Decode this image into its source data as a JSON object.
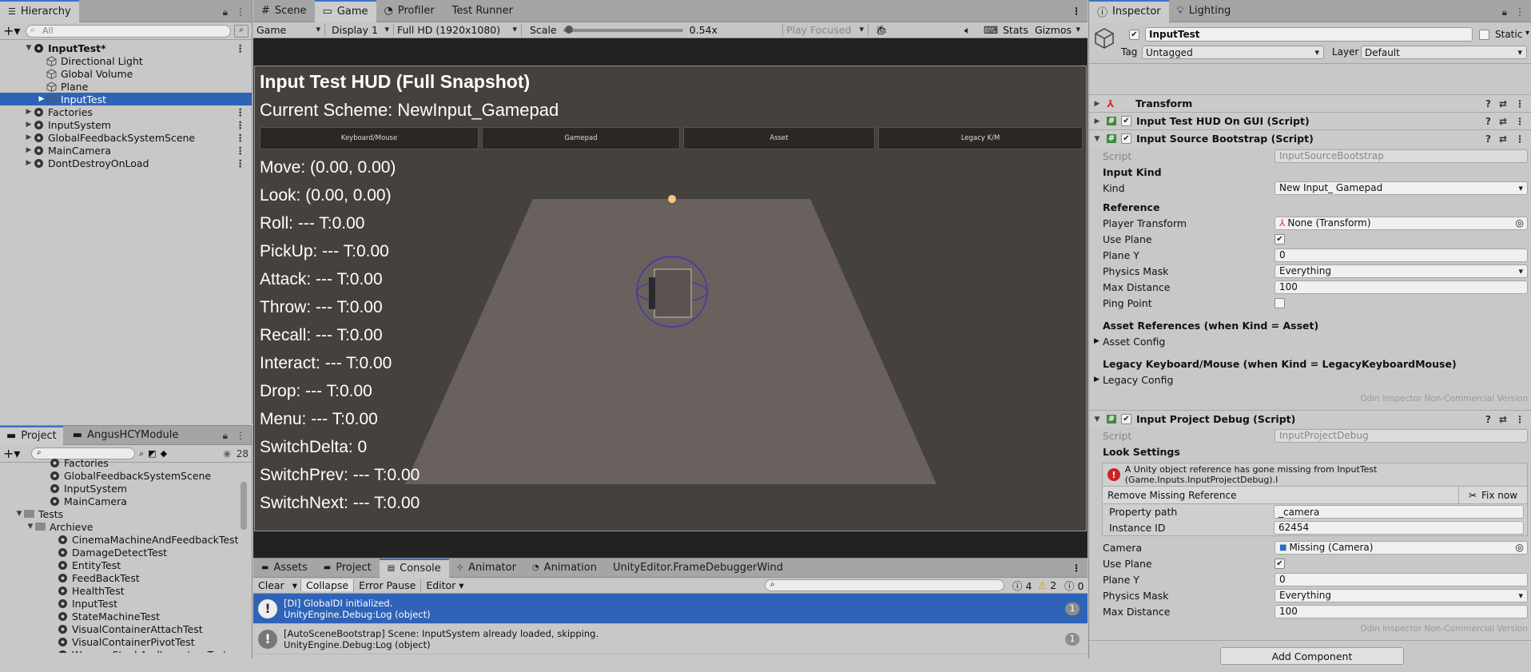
{
  "hierarchy": {
    "tab": "Hierarchy",
    "search_placeholder": "All",
    "scene": "InputTest*",
    "children": [
      "Directional Light",
      "Global Volume",
      "Plane",
      "InputTest"
    ],
    "roots": [
      "Factories",
      "InputSystem",
      "GlobalFeedbackSystemScene",
      "MainCamera",
      "DontDestroyOnLoad"
    ]
  },
  "project": {
    "tabs": [
      "Project",
      "AngusHCYModule"
    ],
    "hidden_count": "28",
    "items": [
      {
        "label": "Factories",
        "depth": 2,
        "type": "scene"
      },
      {
        "label": "GlobalFeedbackSystemScene",
        "depth": 2,
        "type": "scene"
      },
      {
        "label": "InputSystem",
        "depth": 2,
        "type": "scene"
      },
      {
        "label": "MainCamera",
        "depth": 2,
        "type": "scene"
      },
      {
        "label": "Tests",
        "depth": 0,
        "type": "folder"
      },
      {
        "label": "Archieve",
        "depth": 1,
        "type": "folder"
      },
      {
        "label": "CinemaMachineAndFeedbackTest",
        "depth": 3,
        "type": "scene"
      },
      {
        "label": "DamageDetectTest",
        "depth": 3,
        "type": "scene"
      },
      {
        "label": "EntityTest",
        "depth": 3,
        "type": "scene"
      },
      {
        "label": "FeedBackTest",
        "depth": 3,
        "type": "scene"
      },
      {
        "label": "HealthTest",
        "depth": 3,
        "type": "scene"
      },
      {
        "label": "InputTest",
        "depth": 3,
        "type": "scene"
      },
      {
        "label": "StateMachineTest",
        "depth": 3,
        "type": "scene"
      },
      {
        "label": "VisualContainerAttachTest",
        "depth": 3,
        "type": "scene"
      },
      {
        "label": "VisualContainerPivotTest",
        "depth": 3,
        "type": "scene"
      },
      {
        "label": "WeaponStuckAndInventoryTest",
        "depth": 3,
        "type": "scene"
      }
    ]
  },
  "game_tabs": [
    "Scene",
    "Game",
    "Profiler",
    "Test Runner"
  ],
  "game_toolbar": {
    "view": "Game",
    "display": "Display 1",
    "resolution": "Full HD (1920x1080)",
    "scale_label": "Scale",
    "scale_value": "0.54x",
    "play_mode": "Play Focused",
    "stats": "Stats",
    "gizmos": "Gizmos",
    "scale_fraction": 0.02
  },
  "hud": {
    "title": "Input Test HUD (Full Snapshot)",
    "scheme": "Current Scheme: NewInput_Gamepad",
    "buttons": [
      "Keyboard/Mouse",
      "Gamepad",
      "Asset",
      "Legacy K/M"
    ],
    "lines": [
      "Move: (0.00, 0.00)",
      "Look: (0.00, 0.00)",
      "Roll: ---  T:0.00",
      "PickUp: ---  T:0.00",
      "Attack: ---  T:0.00",
      "Throw: ---  T:0.00",
      "Recall: ---  T:0.00",
      "Interact: ---  T:0.00",
      "Drop: ---  T:0.00",
      "Menu: ---  T:0.00",
      "SwitchDelta: 0",
      "SwitchPrev: ---  T:0.00",
      "SwitchNext: ---  T:0.00"
    ]
  },
  "console": {
    "tabs": [
      "Assets",
      "Project",
      "Console",
      "Animator",
      "Animation",
      "UnityEditor.FrameDebuggerWind"
    ],
    "toolbar": {
      "clear": "Clear",
      "collapse": "Collapse",
      "error_pause": "Error Pause",
      "editor": "Editor",
      "info_count": "4",
      "warn_count": "2",
      "error_count": "0"
    },
    "logs": [
      {
        "line1": "[DI] GlobalDI initialized.",
        "line2": "UnityEngine.Debug:Log (object)",
        "count": "1",
        "selected": true
      },
      {
        "line1": "[AutoSceneBootstrap] Scene: InputSystem already loaded, skipping.",
        "line2": "UnityEngine.Debug:Log (object)",
        "count": "1",
        "selected": false
      }
    ]
  },
  "inspector": {
    "tabs": [
      "Inspector",
      "Lighting"
    ],
    "object_name": "InputTest",
    "static_label": "Static",
    "tag_label": "Tag",
    "tag_value": "Untagged",
    "layer_label": "Layer",
    "layer_value": "Default",
    "components": {
      "transform": "Transform",
      "hud": "Input Test HUD On GUI (Script)",
      "bootstrap": "Input Source Bootstrap (Script)",
      "debug": "Input Project Debug (Script)"
    },
    "bootstrap": {
      "script_label": "Script",
      "script_value": "InputSourceBootstrap",
      "h_input_kind": "Input Kind",
      "kind_label": "Kind",
      "kind_value": "New Input_ Gamepad",
      "h_reference": "Reference",
      "player_transform_label": "Player Transform",
      "player_transform_value": "None (Transform)",
      "use_plane_label": "Use Plane",
      "plane_y_label": "Plane Y",
      "plane_y_value": "0",
      "physics_mask_label": "Physics Mask",
      "physics_mask_value": "Everything",
      "max_distance_label": "Max Distance",
      "max_distance_value": "100",
      "ping_point_label": "Ping Point",
      "h_asset_refs": "Asset References (when Kind = Asset)",
      "asset_config": "Asset Config",
      "h_legacy": "Legacy Keyboard/Mouse (when Kind = LegacyKeyboardMouse)",
      "legacy_config": "Legacy Config",
      "odin": "Odin Inspector Non-Commercial Version"
    },
    "debug": {
      "script_label": "Script",
      "script_value": "InputProjectDebug",
      "h_look": "Look Settings",
      "error_msg": "A Unity object reference has gone missing from InputTest (Game.Inputs.InputProjectDebug).I",
      "remove_ref": "Remove Missing Reference",
      "fix_now": "Fix now",
      "property_path_label": "Property path",
      "property_path_value": "_camera",
      "instance_id_label": "Instance ID",
      "instance_id_value": "62454",
      "camera_label": "Camera",
      "camera_value": "Missing (Camera)",
      "use_plane_label": "Use Plane",
      "plane_y_label": "Plane Y",
      "plane_y_value": "0",
      "physics_mask_label": "Physics Mask",
      "physics_mask_value": "Everything",
      "max_distance_label": "Max Distance",
      "max_distance_value": "100",
      "odin": "Odin Inspector Non-Commercial Version"
    },
    "add_component": "Add Component"
  }
}
